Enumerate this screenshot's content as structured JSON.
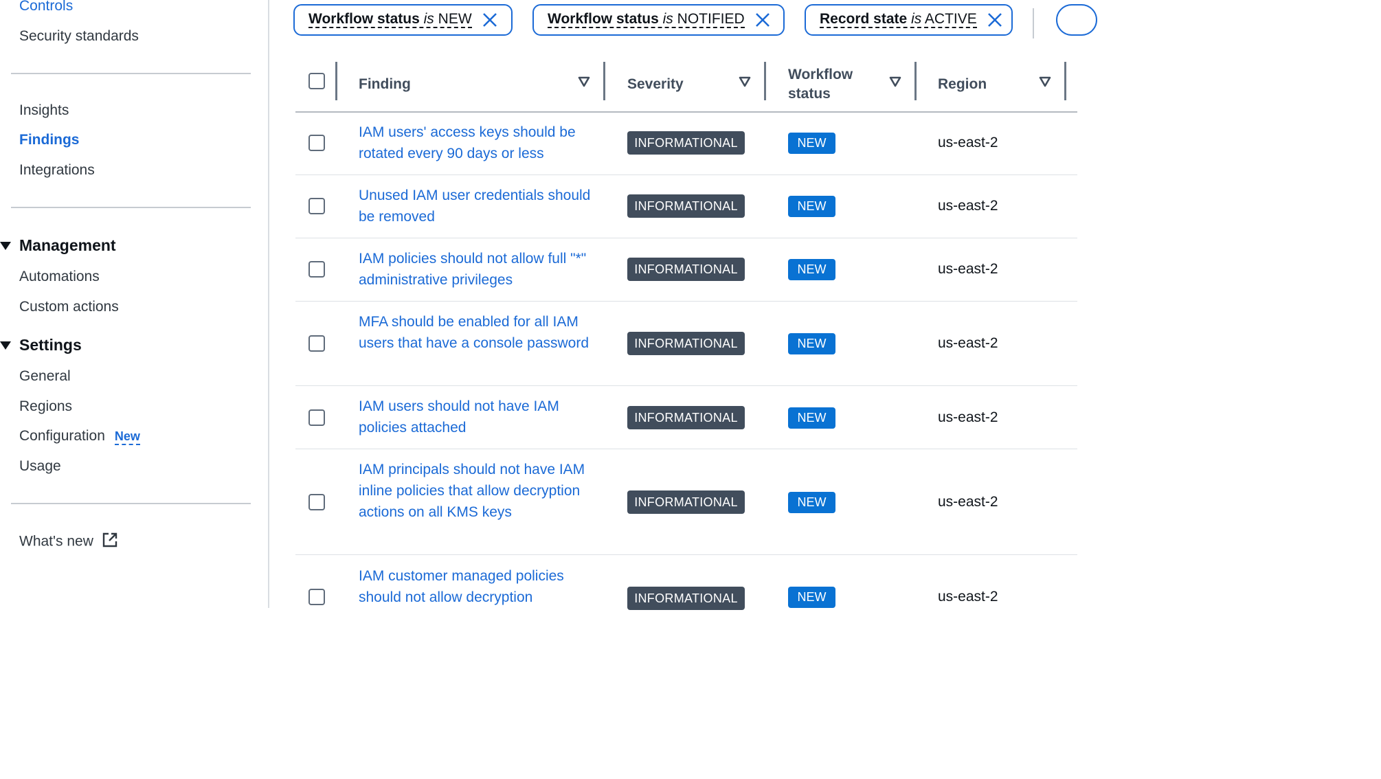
{
  "sidebar": {
    "items_top": [
      {
        "label": "Controls"
      },
      {
        "label": "Security standards"
      }
    ],
    "items_mid": [
      {
        "label": "Insights"
      },
      {
        "label": "Findings"
      },
      {
        "label": "Integrations"
      }
    ],
    "management": {
      "title": "Management",
      "items": [
        {
          "label": "Automations"
        },
        {
          "label": "Custom actions"
        }
      ]
    },
    "settings": {
      "title": "Settings",
      "items": [
        {
          "label": "General"
        },
        {
          "label": "Regions"
        },
        {
          "label": "Configuration",
          "badge": "New"
        },
        {
          "label": "Usage"
        }
      ]
    },
    "whats_new": "What's new"
  },
  "filters": [
    {
      "property": "Workflow status",
      "operator": "is",
      "value": "NEW"
    },
    {
      "property": "Workflow status",
      "operator": "is",
      "value": "NOTIFIED"
    },
    {
      "property": "Record state",
      "operator": "is",
      "value": "ACTIVE"
    }
  ],
  "table": {
    "columns": {
      "finding": "Finding",
      "severity": "Severity",
      "workflow_status_l1": "Workflow",
      "workflow_status_l2": "status",
      "region": "Region"
    },
    "rows": [
      {
        "finding": "IAM users' access keys should be rotated every 90 days or less",
        "severity": "INFORMATIONAL",
        "workflow": "NEW",
        "region": "us-east-2"
      },
      {
        "finding": "Unused IAM user credentials should be removed",
        "severity": "INFORMATIONAL",
        "workflow": "NEW",
        "region": "us-east-2"
      },
      {
        "finding": "IAM policies should not allow full \"*\" administrative privileges",
        "severity": "INFORMATIONAL",
        "workflow": "NEW",
        "region": "us-east-2"
      },
      {
        "finding": "MFA should be enabled for all IAM users that have a console password",
        "severity": "INFORMATIONAL",
        "workflow": "NEW",
        "region": "us-east-2"
      },
      {
        "finding": "IAM users should not have IAM policies attached",
        "severity": "INFORMATIONAL",
        "workflow": "NEW",
        "region": "us-east-2"
      },
      {
        "finding": "IAM principals should not have IAM inline policies that allow decryption actions on all KMS keys",
        "severity": "INFORMATIONAL",
        "workflow": "NEW",
        "region": "us-east-2"
      },
      {
        "finding": "IAM customer managed policies should not allow decryption",
        "severity": "INFORMATIONAL",
        "workflow": "NEW",
        "region": "us-east-2"
      }
    ]
  },
  "colors": {
    "link_blue": "#1b6ad6",
    "severity_badge": "#414d5c",
    "workflow_badge": "#0972d3"
  }
}
